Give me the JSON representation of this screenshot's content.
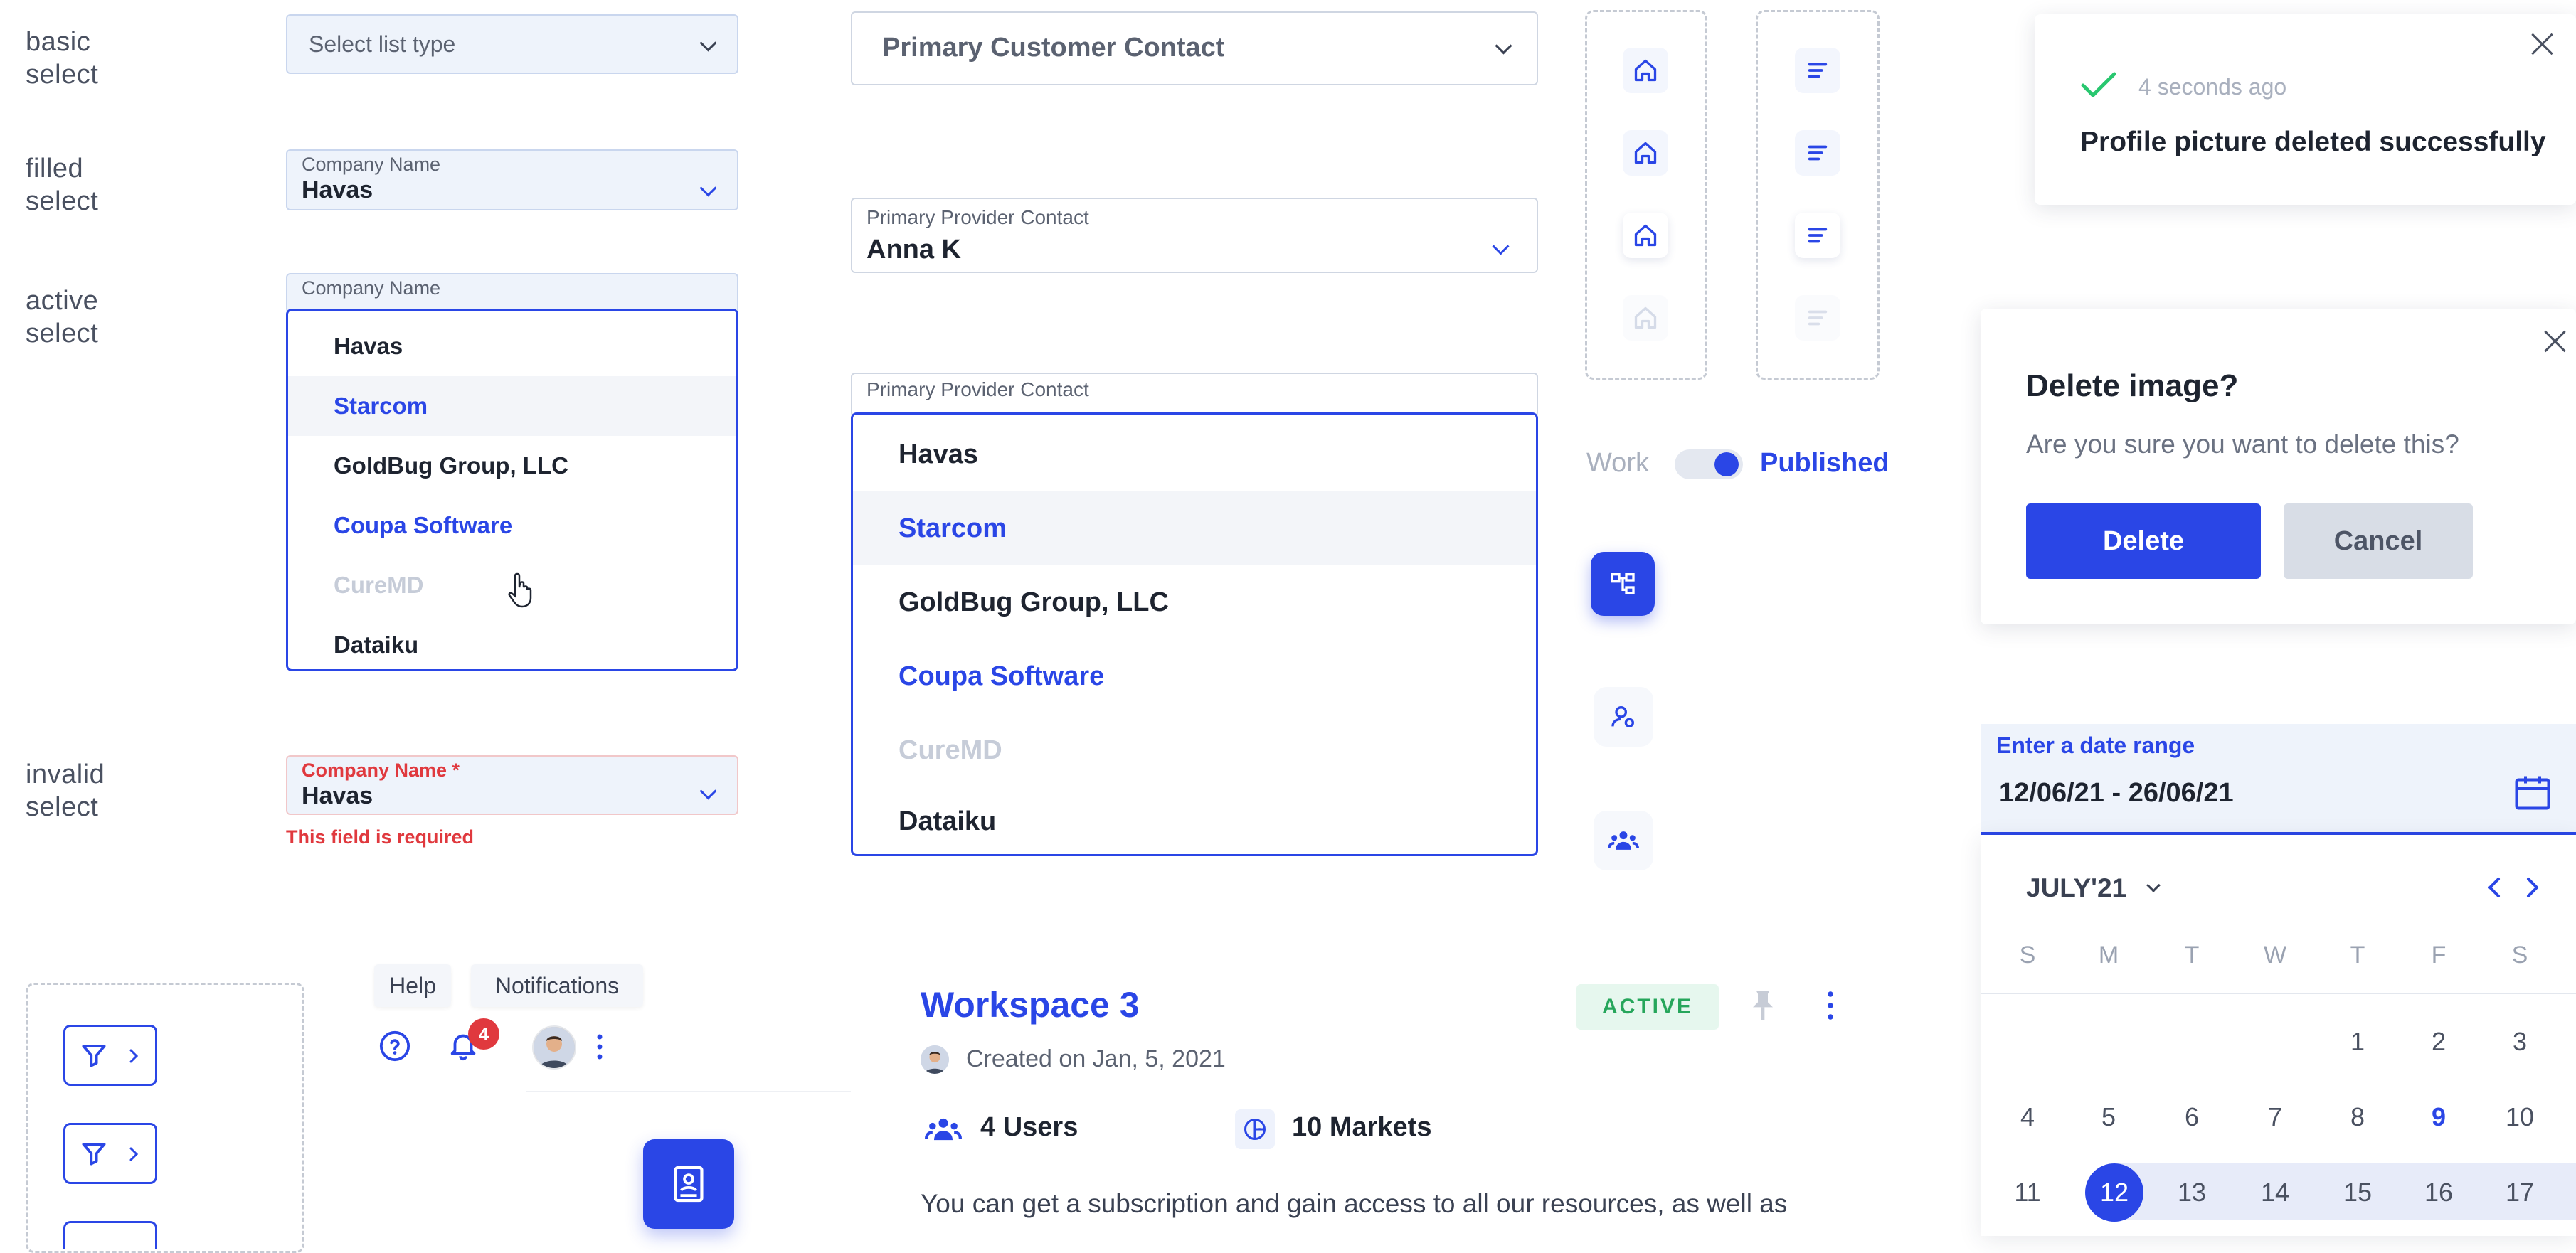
{
  "row_labels": {
    "basic": "basic\nselect",
    "filled": "filled\nselect",
    "active": "active\nselect",
    "invalid": "invalid\nselect"
  },
  "basic_select": {
    "placeholder": "Select list type"
  },
  "big_select": {
    "value": "Primary Customer Contact"
  },
  "filled_select": {
    "label": "Company Name",
    "value": "Havas"
  },
  "filled_big_select": {
    "label": "Primary Provider Contact",
    "value": "Anna K"
  },
  "active_select": {
    "label": "Company Name",
    "options": [
      {
        "text": "Havas",
        "state": "normal"
      },
      {
        "text": "Starcom",
        "state": "highlighted"
      },
      {
        "text": "GoldBug Group, LLC",
        "state": "normal"
      },
      {
        "text": "Coupa Software",
        "state": "selected"
      },
      {
        "text": "CureMD",
        "state": "disabled"
      },
      {
        "text": "Dataiku",
        "state": "normal"
      }
    ]
  },
  "active_big_select": {
    "label": "Primary Provider Contact",
    "options": [
      {
        "text": "Havas",
        "state": "normal"
      },
      {
        "text": "Starcom",
        "state": "highlighted"
      },
      {
        "text": "GoldBug Group, LLC",
        "state": "normal"
      },
      {
        "text": "Coupa Software",
        "state": "selected"
      },
      {
        "text": "CureMD",
        "state": "disabled"
      },
      {
        "text": "Dataiku",
        "state": "normal"
      }
    ]
  },
  "invalid_select": {
    "label": "Company Name *",
    "value": "Havas",
    "error": "This field is required"
  },
  "toggle": {
    "off_label": "Work",
    "on_label": "Published",
    "on": true
  },
  "toast": {
    "time": "4 seconds ago",
    "message": "Profile picture deleted successfully"
  },
  "dialog": {
    "title": "Delete image?",
    "body": "Are you sure you want to delete this?",
    "confirm": "Delete",
    "cancel": "Cancel"
  },
  "date_range": {
    "label": "Enter a date range",
    "value": "12/06/21 - 26/06/21",
    "month": "JULY'21",
    "weekdays": [
      "S",
      "M",
      "T",
      "W",
      "T",
      "F",
      "S"
    ],
    "weeks": [
      [
        "",
        "",
        "",
        "",
        "1",
        "2",
        "3"
      ],
      [
        "4",
        "5",
        "6",
        "7",
        "8",
        "9",
        "10"
      ],
      [
        "11",
        "12",
        "13",
        "14",
        "15",
        "16",
        "17"
      ]
    ],
    "today": "9",
    "range_start": "12",
    "range_end": "17"
  },
  "header": {
    "help_tip": "Help",
    "notifications_tip": "Notifications",
    "notification_count": "4"
  },
  "workspace": {
    "title": "Workspace 3",
    "status": "ACTIVE",
    "created": "Created on Jan, 5, 2021",
    "users": "4 Users",
    "markets": "10 Markets",
    "description": "You can get a subscription and gain access to all our resources, as well as"
  },
  "colors": {
    "primary": "#2a46e6",
    "error": "#e0393e",
    "success": "#28c76f",
    "active_badge_bg": "#e6f7ee",
    "active_badge_text": "#26a65b"
  }
}
